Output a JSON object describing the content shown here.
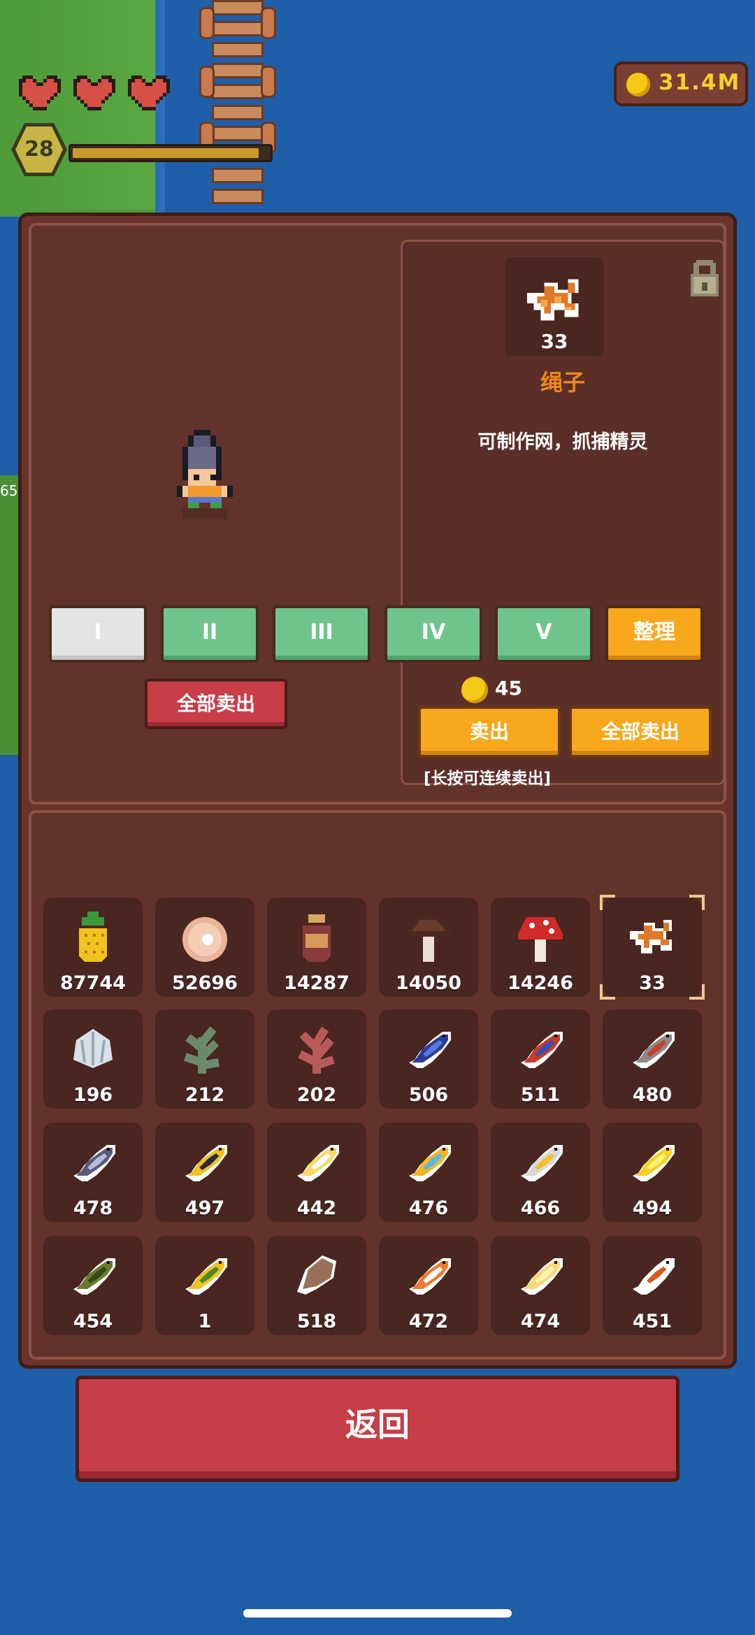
{
  "hud": {
    "hearts": 3,
    "level": "28",
    "xp_fraction": 0.95,
    "coins": "31.4M"
  },
  "map": {
    "side_number": "65"
  },
  "character_panel": {
    "sell_all_label": "全部卖出"
  },
  "detail": {
    "item_count": "33",
    "item_name": "绳子",
    "description": "可制作网，抓捕精灵",
    "price": "45",
    "sell_label": "卖出",
    "sell_all_label": "全部卖出",
    "hint": "[长按可连续卖出]",
    "locked": true
  },
  "tabs": [
    {
      "label": "I",
      "active": true
    },
    {
      "label": "II",
      "active": false
    },
    {
      "label": "III",
      "active": false
    },
    {
      "label": "IV",
      "active": false
    },
    {
      "label": "V",
      "active": false
    }
  ],
  "sort_label": "整理",
  "inventory": [
    {
      "icon": "pineapple-icon",
      "count": "87744"
    },
    {
      "icon": "pearl-icon",
      "count": "52696"
    },
    {
      "icon": "jar-icon",
      "count": "14287"
    },
    {
      "icon": "brown-mushroom-icon",
      "count": "14050"
    },
    {
      "icon": "red-mushroom-icon",
      "count": "14246"
    },
    {
      "icon": "rope-icon",
      "count": "33",
      "selected": true
    },
    {
      "icon": "shell-icon",
      "count": "196"
    },
    {
      "icon": "green-seaweed-icon",
      "count": "212"
    },
    {
      "icon": "red-coral-icon",
      "count": "202"
    },
    {
      "icon": "blue-fish-icon",
      "count": "506"
    },
    {
      "icon": "red-blue-fish-icon",
      "count": "511"
    },
    {
      "icon": "gray-red-fish-icon",
      "count": "480"
    },
    {
      "icon": "gray-fish-icon",
      "count": "478"
    },
    {
      "icon": "yellow-striped-fish-icon",
      "count": "497"
    },
    {
      "icon": "yellow-white-fish-icon",
      "count": "442"
    },
    {
      "icon": "gold-fish-icon",
      "count": "476"
    },
    {
      "icon": "white-fish-icon",
      "count": "466"
    },
    {
      "icon": "golden-fish-icon",
      "count": "494"
    },
    {
      "icon": "green-fish-icon",
      "count": "454"
    },
    {
      "icon": "yellow-green-fish-icon",
      "count": "1"
    },
    {
      "icon": "flatfish-icon",
      "count": "518"
    },
    {
      "icon": "clownfish-icon",
      "count": "472"
    },
    {
      "icon": "pale-gold-fish-icon",
      "count": "474"
    },
    {
      "icon": "koi-fish-icon",
      "count": "451"
    }
  ],
  "back_label": "返回"
}
